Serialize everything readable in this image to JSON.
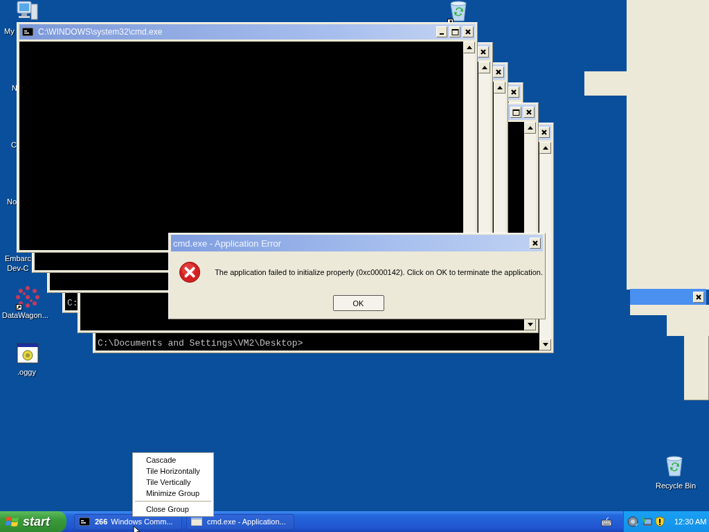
{
  "desktop_icons": [
    {
      "kind": "computer",
      "label": "My",
      "shortcut": false
    },
    {
      "kind": "label_only",
      "label": "N"
    },
    {
      "kind": "label_only",
      "label": "C"
    },
    {
      "kind": "label_only",
      "label": "No"
    },
    {
      "kind": "label_only",
      "label": "Embarc\nDev-C"
    },
    {
      "kind": "molecule",
      "label": "DataWagon...",
      "shortcut": true
    },
    {
      "kind": "program",
      "label": ".oggy",
      "shortcut": false
    },
    {
      "kind": "recycle_bin",
      "shortcut": true
    },
    {
      "kind": "recycle_bin",
      "label": "Recycle Bin",
      "shortcut": false
    }
  ],
  "console_windows": [
    {
      "title": "C:\\WINDOWS\\system32\\cmd.exe",
      "title_buttons": [
        {
          "kind": "minimize"
        },
        {
          "kind": "maximize"
        },
        {
          "kind": "close"
        }
      ]
    },
    {
      "title_buttons": [
        {
          "kind": "close"
        }
      ]
    },
    {
      "title_buttons": [
        {
          "kind": "close"
        }
      ]
    },
    {
      "title_buttons": [
        {
          "kind": "close"
        }
      ],
      "lines": [
        "C:"
      ]
    },
    {
      "title_buttons": [
        {
          "kind": "maximize"
        },
        {
          "kind": "close"
        }
      ]
    },
    {
      "title_buttons": [
        {
          "kind": "close"
        }
      ],
      "lines": [
        "C:\\Documents and Settings\\VM2\\Desktop>"
      ]
    }
  ],
  "remnant_window": {
    "title_buttons": [
      {
        "kind": "close"
      }
    ]
  },
  "error_dialog": {
    "title": "cmd.exe - Application Error",
    "message": "The application failed to initialize properly (0xc0000142). Click on OK to terminate the application.",
    "buttons": [
      "OK"
    ]
  },
  "context_menu": {
    "items": [
      {
        "kind": "item",
        "label": "Cascade"
      },
      {
        "kind": "item",
        "label": "Tile Horizontally"
      },
      {
        "kind": "item",
        "label": "Tile Vertically"
      },
      {
        "kind": "item",
        "label": "Minimize Group"
      },
      {
        "kind": "separator"
      },
      {
        "kind": "item",
        "label": "Close Group"
      }
    ]
  },
  "taskbar": {
    "start_label": "start",
    "buttons": [
      {
        "kind": "group",
        "count": "266",
        "label": "Windows Comm...",
        "selected": false
      },
      {
        "kind": "dialog",
        "label": "cmd.exe - Application...",
        "selected": false
      }
    ],
    "clock": "12:30 AM"
  }
}
